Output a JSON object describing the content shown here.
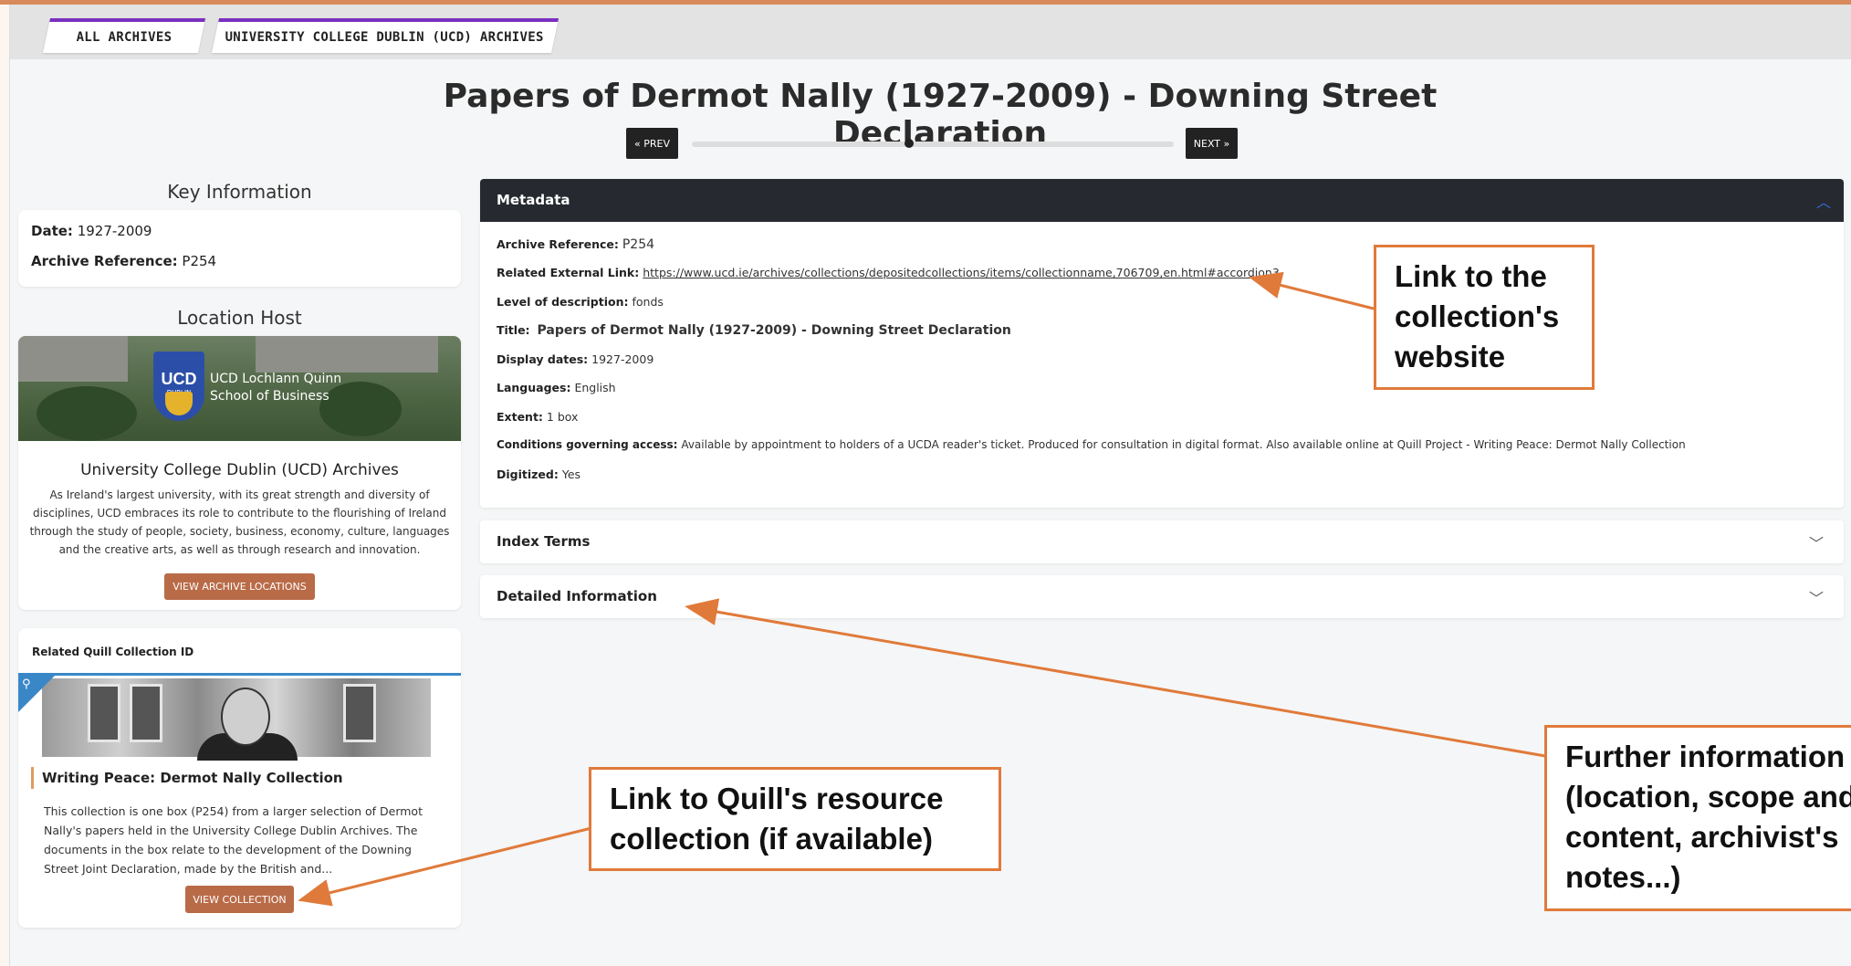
{
  "breadcrumbs": [
    "ALL ARCHIVES",
    "UNIVERSITY COLLEGE DUBLIN (UCD) ARCHIVES"
  ],
  "page_title": "Papers of Dermot Nally (1927-2009) - Downing Street Declaration",
  "nav": {
    "prev": "« PREV",
    "next": "NEXT »",
    "position_fraction": 0.45
  },
  "key_information": {
    "heading": "Key Information",
    "date_label": "Date:",
    "date_value": "1927-2009",
    "ref_label": "Archive Reference:",
    "ref_value": "P254"
  },
  "location_host": {
    "heading": "Location Host",
    "banner_text_line1": "UCD Lochlann Quinn",
    "banner_text_line2": "School of Business",
    "logo_text": "UCD",
    "logo_subtext": "DUBLIN",
    "name": "University College Dublin (UCD) Archives",
    "description": "As Ireland's largest university, with its great strength and diversity of disciplines, UCD embraces its role to contribute to the flourishing of Ireland through the study of people, society, business, economy, culture, languages and the creative arts, as well as through research and innovation.",
    "button": "VIEW ARCHIVE LOCATIONS"
  },
  "quill": {
    "label": "Related Quill Collection ID",
    "title": "Writing Peace: Dermot Nally Collection",
    "description": "This collection is one box (P254) from a larger selection of Dermot Nally's papers held in the University College Dublin Archives. The documents in the box relate to the development of the Downing Street Joint Declaration, made by the British and...",
    "button": "VIEW COLLECTION"
  },
  "metadata": {
    "heading": "Metadata",
    "rows": {
      "archive_ref": {
        "label": "Archive Reference:",
        "value": "P254"
      },
      "external_link": {
        "label": "Related External Link:",
        "value": "https://www.ucd.ie/archives/collections/depositedcollections/items/collectionname,706709,en.html#accordion3"
      },
      "level": {
        "label": "Level of description:",
        "value": "fonds"
      },
      "title": {
        "label": "Title:",
        "value": "Papers of Dermot Nally (1927-2009) - Downing Street Declaration"
      },
      "display_dates": {
        "label": "Display dates:",
        "value": "1927-2009"
      },
      "languages": {
        "label": "Languages:",
        "value": "English"
      },
      "extent": {
        "label": "Extent:",
        "value": "1 box"
      },
      "conditions": {
        "label": "Conditions governing access:",
        "value": "Available by appointment to holders of a UCDA reader's ticket. Produced for consultation in digital format. Also available online at Quill Project - Writing Peace: Dermot Nally Collection"
      },
      "digitized": {
        "label": "Digitized:",
        "value": "Yes"
      }
    }
  },
  "accordions": {
    "index_terms": "Index Terms",
    "detailed_info": "Detailed Information"
  },
  "callouts": {
    "website_line1": "Link to the",
    "website_line2": "collection's",
    "website_line3": "website",
    "quill_line1": "Link to Quill's resource",
    "quill_line2": "collection (if available)",
    "further_line1": "Further information",
    "further_line2": "(location, scope and",
    "further_line3": "content, archivist's",
    "further_line4": "notes...)"
  },
  "colors": {
    "accent_purple": "#7a2fc0",
    "button_orange": "#b96b48",
    "callout_orange": "#e07a3a",
    "header_dark": "#262a30",
    "clip_blue": "#3a87c8"
  },
  "icons": [
    "chevron-up-icon",
    "chevron-down-icon",
    "paperclip-icon"
  ]
}
